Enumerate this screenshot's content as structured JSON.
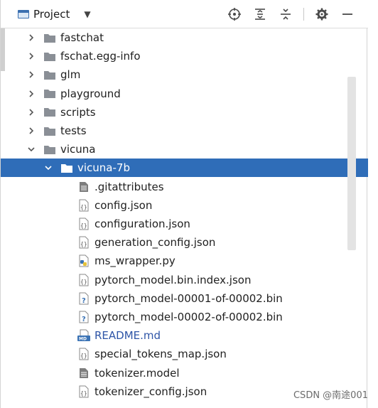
{
  "panel": {
    "title": "Project",
    "toolbar_icons": [
      "crosshair-icon",
      "expand-all-icon",
      "collapse-all-icon",
      "gear-icon",
      "minimize-icon"
    ]
  },
  "tree": [
    {
      "label": "fastchat",
      "kind": "folder",
      "expanded": false
    },
    {
      "label": "fschat.egg-info",
      "kind": "folder",
      "expanded": false
    },
    {
      "label": "glm",
      "kind": "folder",
      "expanded": false
    },
    {
      "label": "playground",
      "kind": "folder",
      "expanded": false
    },
    {
      "label": "scripts",
      "kind": "folder",
      "expanded": false
    },
    {
      "label": "tests",
      "kind": "folder",
      "expanded": false
    },
    {
      "label": "vicuna",
      "kind": "folder",
      "expanded": true
    },
    {
      "label": "vicuna-7b",
      "kind": "folder",
      "expanded": true,
      "selected": true
    },
    {
      "label": ".gitattributes",
      "kind": "text-file"
    },
    {
      "label": "config.json",
      "kind": "json-file"
    },
    {
      "label": "configuration.json",
      "kind": "json-file"
    },
    {
      "label": "generation_config.json",
      "kind": "json-file"
    },
    {
      "label": "ms_wrapper.py",
      "kind": "python-file"
    },
    {
      "label": "pytorch_model.bin.index.json",
      "kind": "json-file"
    },
    {
      "label": "pytorch_model-00001-of-00002.bin",
      "kind": "unknown-file"
    },
    {
      "label": "pytorch_model-00002-of-00002.bin",
      "kind": "unknown-file"
    },
    {
      "label": "README.md",
      "kind": "markdown-file"
    },
    {
      "label": "special_tokens_map.json",
      "kind": "json-file"
    },
    {
      "label": "tokenizer.model",
      "kind": "text-file"
    },
    {
      "label": "tokenizer_config.json",
      "kind": "json-file"
    }
  ],
  "watermark": "CSDN @南途001",
  "colors": {
    "selection": "#2f6db8",
    "folder": "#8a8f96",
    "readme_text": "#2e55a7"
  }
}
